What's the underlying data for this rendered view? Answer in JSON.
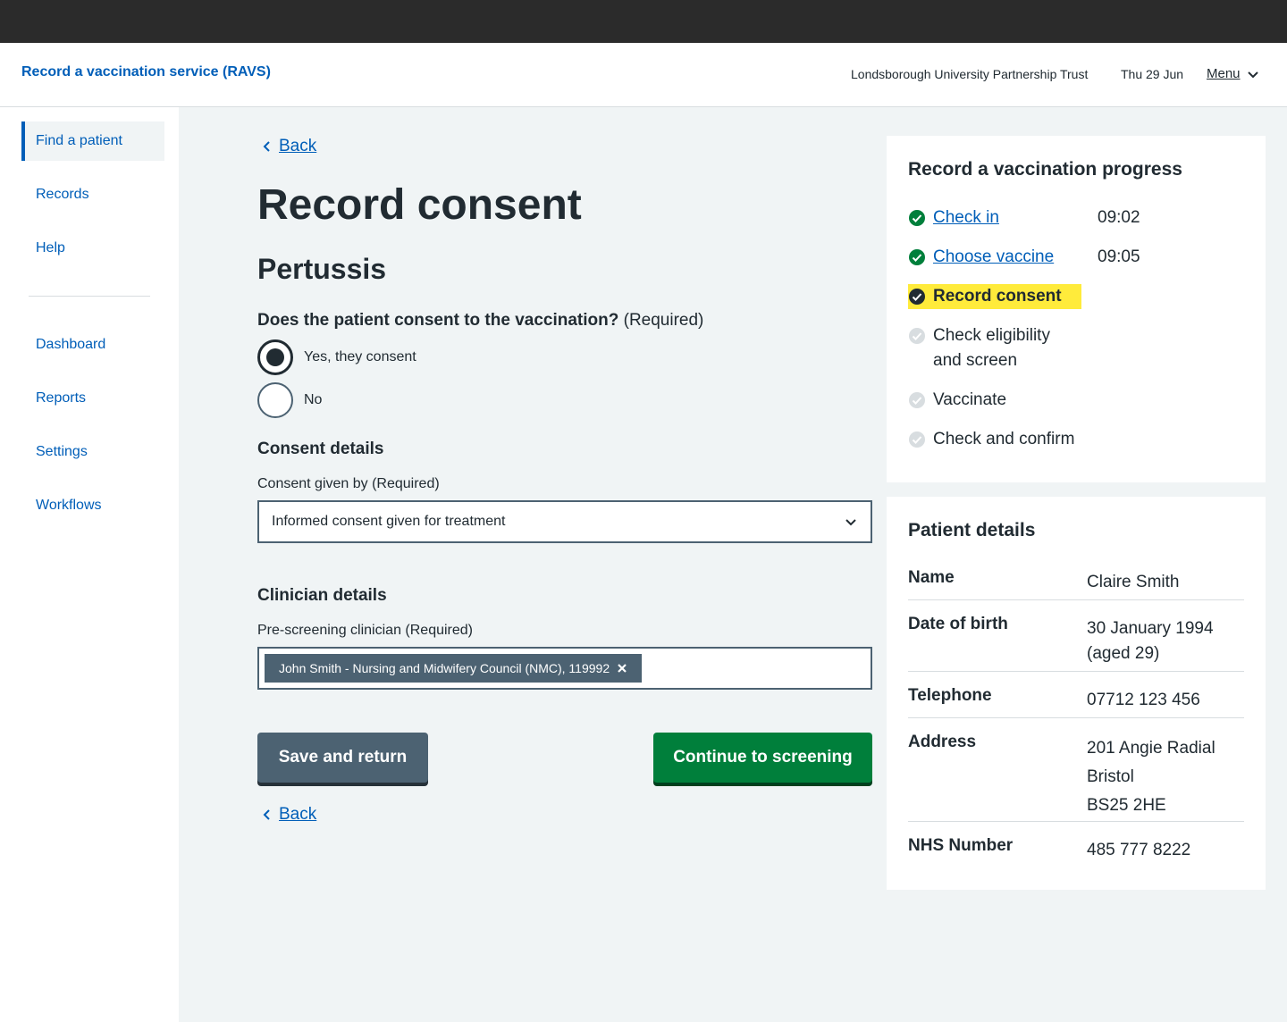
{
  "header": {
    "service_name": "Record a vaccination service (RAVS)",
    "organisation": "Londsborough University Partnership Trust",
    "date": "Thu 29 Jun",
    "menu_label": "Menu"
  },
  "sidebar": {
    "items": [
      {
        "label": "Find a patient",
        "active": true
      },
      {
        "label": "Records"
      },
      {
        "label": "Help"
      },
      {
        "label": "Dashboard"
      },
      {
        "label": "Reports"
      },
      {
        "label": "Settings"
      },
      {
        "label": "Workflows"
      }
    ]
  },
  "main": {
    "back_label": "Back",
    "title": "Record consent",
    "vaccine": "Pertussis",
    "consent_question": "Does the patient consent to the vaccination?",
    "required_suffix": "(Required)",
    "radio_options": [
      {
        "label": "Yes, they consent",
        "checked": true
      },
      {
        "label": "No",
        "checked": false
      }
    ],
    "consent_details_heading": "Consent details",
    "consent_given_by_label": "Consent given by (Required)",
    "consent_given_by_value": "Informed consent given for treatment",
    "clinician_heading": "Clinician details",
    "clinician_label": "Pre-screening clinician (Required)",
    "clinician_chip": "John Smith - Nursing and Midwifery Council (NMC), 119992",
    "save_button": "Save and return",
    "continue_button": "Continue to screening"
  },
  "progress": {
    "title": "Record a vaccination progress",
    "steps": [
      {
        "label": "Check in",
        "status": "done",
        "time": "09:02"
      },
      {
        "label": "Choose vaccine",
        "status": "done",
        "time": "09:05"
      },
      {
        "label": "Record consent",
        "status": "current"
      },
      {
        "label": "Check eligibility",
        "label_line2": "and screen",
        "status": "pending"
      },
      {
        "label": "Vaccinate",
        "status": "pending"
      },
      {
        "label": "Check and confirm",
        "status": "pending"
      }
    ]
  },
  "patient": {
    "title": "Patient details",
    "rows": [
      {
        "key": "Name",
        "value": [
          "Claire Smith"
        ]
      },
      {
        "key": "Date of birth",
        "value": [
          "30 January 1994",
          "(aged 29)"
        ]
      },
      {
        "key": "Telephone",
        "value": [
          "07712 123 456"
        ]
      },
      {
        "key": "Address",
        "value": [
          "201 Angie Radial",
          "Bristol",
          "BS25 2HE"
        ]
      },
      {
        "key": "NHS Number",
        "value": [
          "485 777 8222"
        ]
      }
    ]
  },
  "colors": {
    "link": "#005eb8",
    "primary_button": "#007f3b",
    "secondary_button": "#4c6272",
    "highlight": "#ffeb3b",
    "done_icon": "#007f3b",
    "pending_icon": "#d8dde0"
  }
}
